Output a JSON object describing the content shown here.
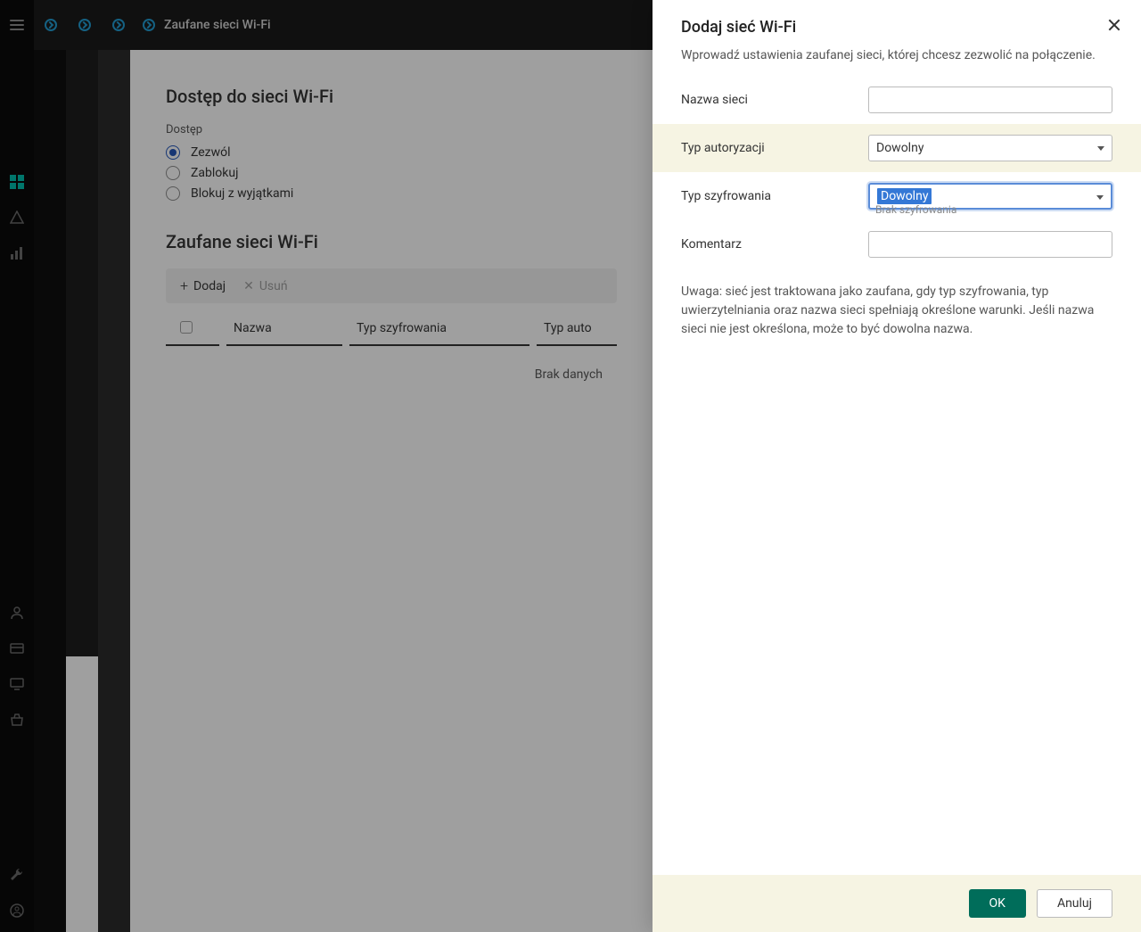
{
  "header": {
    "title": "Zaufane sieci Wi-Fi"
  },
  "main": {
    "access_section_title": "Dostęp do sieci Wi-Fi",
    "access_label": "Dostęp",
    "radio_allow": "Zezwól",
    "radio_block": "Zablokuj",
    "radio_block_except": "Blokuj z wyjątkami",
    "trusted_section_title": "Zaufane sieci Wi-Fi",
    "toolbar_add": "Dodaj",
    "toolbar_delete": "Usuń",
    "cols": {
      "name": "Nazwa",
      "encryption": "Typ szyfrowania",
      "auth": "Typ auto"
    },
    "no_data": "Brak danych"
  },
  "panel": {
    "title": "Dodaj sieć Wi-Fi",
    "description": "Wprowadź ustawienia zaufanej sieci, której chcesz zezwolić na połączenie.",
    "labels": {
      "network_name": "Nazwa sieci",
      "auth_type": "Typ autoryzacji",
      "encryption_type": "Typ szyfrowania",
      "comment": "Komentarz"
    },
    "auth_type_value": "Dowolny",
    "encryption_type_value": "Dowolny",
    "encryption_dropdown_peek": "Brak szyfrowania",
    "note": "Uwaga: sieć jest traktowana jako zaufana, gdy typ szyfrowania, typ uwierzytelniania oraz nazwa sieci spełniają określone warunki. Jeśli nazwa sieci nie jest określona, może to być dowolna nazwa.",
    "ok": "OK",
    "cancel": "Anuluj"
  }
}
